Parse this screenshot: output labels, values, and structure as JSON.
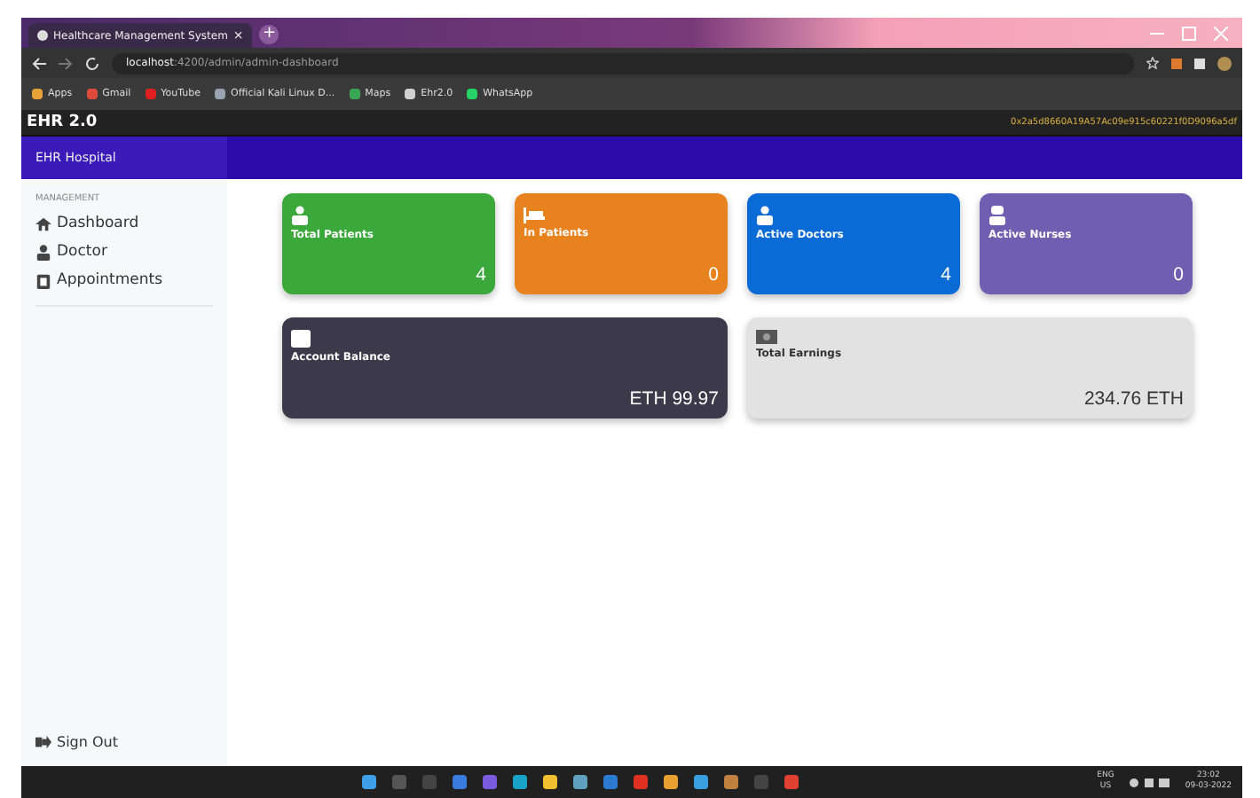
{
  "browser": {
    "tab_title": "Healthcare Management System",
    "tab_close": "×",
    "new_tab": "+",
    "url_host": "localhost",
    "url_path": ":4200/admin/admin-dashboard",
    "bookmarks": [
      {
        "label": "Apps",
        "color": "#e8a23a"
      },
      {
        "label": "Gmail",
        "color": "#e04a3a"
      },
      {
        "label": "YouTube",
        "color": "#e02020"
      },
      {
        "label": "Official Kali Linux D...",
        "color": "#9aa4b0"
      },
      {
        "label": "Maps",
        "color": "#3aa757"
      },
      {
        "label": "Ehr2.0",
        "color": "#d0d0d0"
      },
      {
        "label": "WhatsApp",
        "color": "#25d366"
      }
    ]
  },
  "app": {
    "brand": "EHR 2.0",
    "account": "0x2a5d8660A19A57Ac09e915c60221f0D9096a5df",
    "hospital": "EHR Hospital"
  },
  "sidebar": {
    "section": "MANAGEMENT",
    "items": [
      {
        "label": "Dashboard",
        "kind": "home"
      },
      {
        "label": "Doctor",
        "kind": "person"
      },
      {
        "label": "Appointments",
        "kind": "clipboard"
      }
    ],
    "sign_out": "Sign Out"
  },
  "cards": [
    {
      "title": "Total Patients",
      "value": "4",
      "color": "#3aa83a",
      "kind": "patient"
    },
    {
      "title": "In Patients",
      "value": "0",
      "color": "#e8821e",
      "kind": "bed"
    },
    {
      "title": "Active Doctors",
      "value": "4",
      "color": "#0b6bd6",
      "kind": "patient"
    },
    {
      "title": "Active Nurses",
      "value": "0",
      "color": "#6e5fb0",
      "kind": "nurse"
    },
    {
      "title": "Account Balance",
      "value": "ETH 99.97",
      "color": "#3c3a4a",
      "kind": "wallet"
    },
    {
      "title": "Total Earnings",
      "value": "234.76 ETH",
      "color": "#e2e2e2",
      "kind": "money"
    }
  ],
  "taskbar": {
    "lang": "ENG",
    "region": "US",
    "time": "23:02",
    "date": "09-03-2022"
  }
}
